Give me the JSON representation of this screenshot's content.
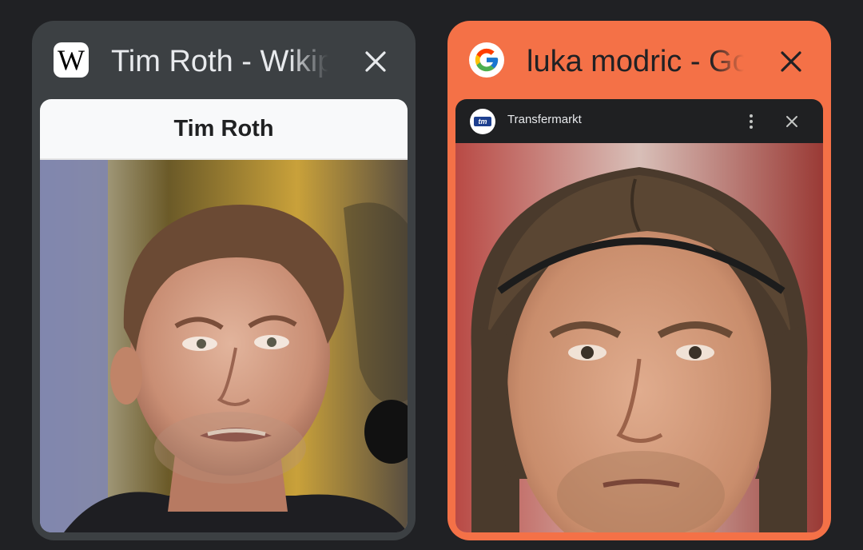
{
  "tabs": [
    {
      "title": "Tim Roth - Wikipedia",
      "favicon": "wikipedia-icon",
      "favicon_letter": "W",
      "selected": false,
      "page": {
        "heading": "Tim Roth",
        "image": "portrait-photo"
      }
    },
    {
      "title": "luka modric - Google Search",
      "favicon": "google-icon",
      "selected": true,
      "page": {
        "site_name": "Transfermarkt",
        "site_logo": "transfermarkt-logo",
        "site_logo_text": "tm",
        "image": "portrait-photo"
      }
    }
  ],
  "colors": {
    "background": "#202124",
    "card": "#3c4043",
    "selected_accent": "#f47147"
  },
  "icons": {
    "close": "close-icon",
    "more": "more-vert-icon"
  }
}
